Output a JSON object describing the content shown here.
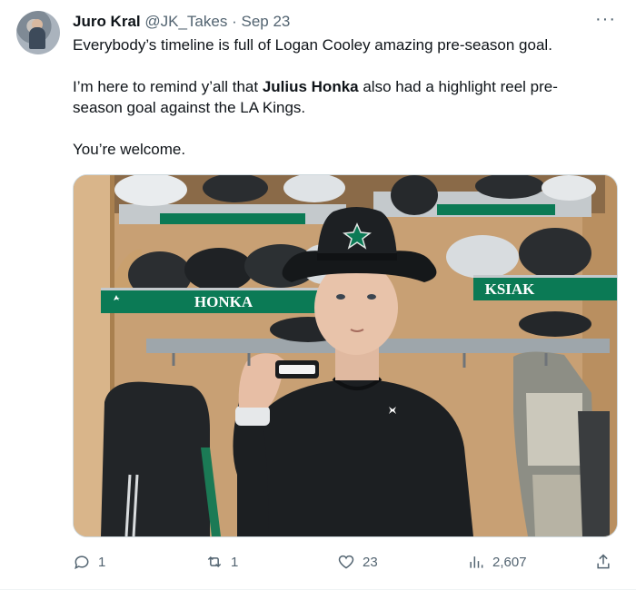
{
  "tweet": {
    "author_name": "Juro Kral",
    "handle": "@JK_Takes",
    "separator": "·",
    "date": "Sep 23",
    "more": "···",
    "paragraph1": "Everybody’s timeline is full of Logan Cooley amazing pre-season goal.",
    "paragraph2_before": "I’m here to remind y’all that ",
    "paragraph2_bold": "Julius Honka",
    "paragraph2_after": " also had a highlight reel pre-season goal against the LA Kings.",
    "paragraph3": "You’re welcome."
  },
  "photo": {
    "nameplate_left": "HONKA",
    "nameplate_right": "KSIAK"
  },
  "actions": {
    "replies": "1",
    "reposts": "1",
    "likes": "23",
    "views": "2,607"
  },
  "colors": {
    "text": "#0f1419",
    "secondary": "#536471",
    "nameplate_green": "#0b7a55",
    "shirt": "#1c1f22"
  }
}
